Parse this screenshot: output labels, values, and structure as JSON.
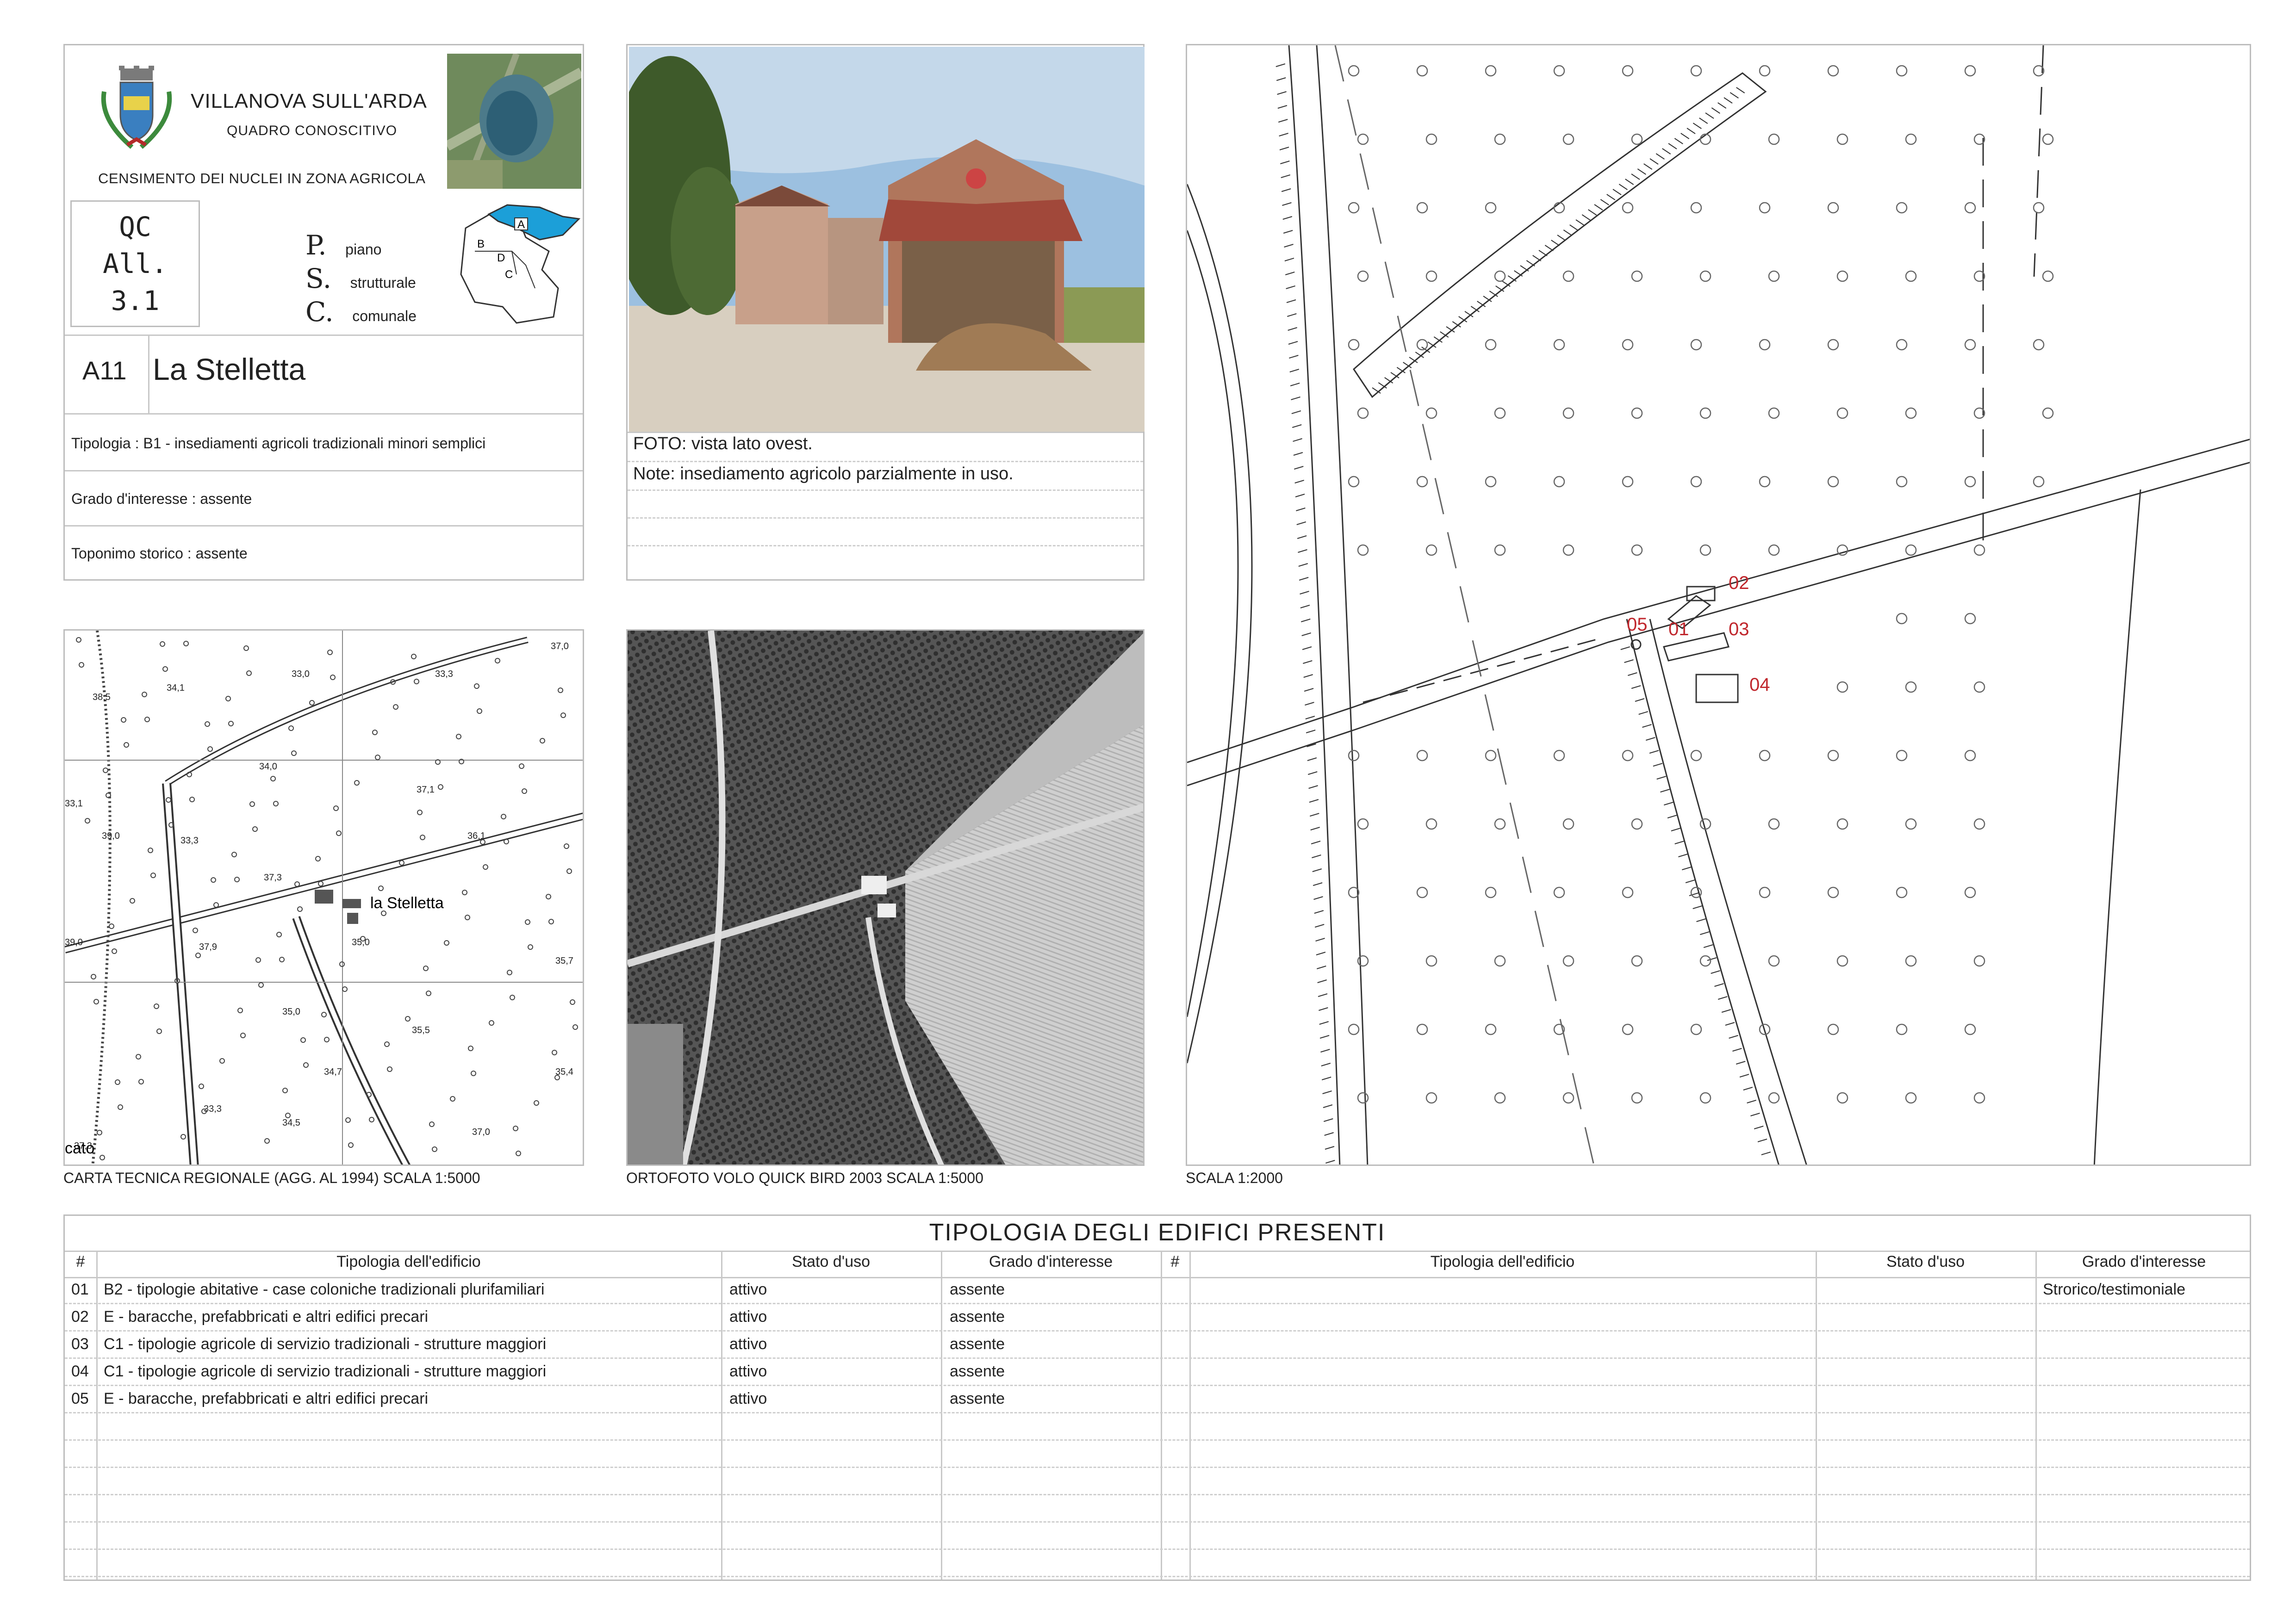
{
  "header": {
    "town": "VILLANOVA SULL'ARDA",
    "subtitle": "QUADRO CONOSCITIVO",
    "census": "CENSIMENTO DEI NUCLEI IN ZONA AGRICOLA",
    "qc_lines": [
      "QC",
      "All.",
      "3.1"
    ],
    "psc": [
      {
        "letter": "P.",
        "word": "piano"
      },
      {
        "letter": "S.",
        "word": "strutturale"
      },
      {
        "letter": "C.",
        "word": "comunale"
      }
    ],
    "zones": [
      "A",
      "B",
      "C",
      "D"
    ],
    "code": "A11",
    "name": "La Stelletta",
    "tipologia": "Tipologia : B1 - insediamenti agricoli tradizionali minori semplici",
    "grado": "Grado d'interesse : assente",
    "toponimo": "Toponimo storico : assente"
  },
  "photo": {
    "caption": "FOTO: vista lato ovest.",
    "note": "Note: insediamento agricolo parzialmente in uso."
  },
  "maps": {
    "ctr_caption": "CARTA TECNICA REGIONALE (AGG. AL 1994) SCALA 1:5000",
    "ortho_caption": "ORTOFOTO VOLO QUICK BIRD 2003 SCALA 1:5000",
    "main_caption": "SCALA 1:2000",
    "ctr_place_name": "la Stelletta",
    "ctr_fragment": "cato",
    "ctr_elevations": [
      "37,0",
      "33,0",
      "33,3",
      "34,1",
      "38,5",
      "34,0",
      "37,1",
      "33,1",
      "39,0",
      "33,3",
      "36,1",
      "37,3",
      "35,0",
      "39,0",
      "37,9",
      "35,7",
      "35,0",
      "35,5",
      "34,7",
      "35,4",
      "33,3",
      "34,5",
      "37,0",
      "37,3"
    ],
    "building_labels": [
      "05",
      "01",
      "02",
      "03",
      "04"
    ]
  },
  "table": {
    "title": "TIPOLOGIA DEGLI EDIFICI PRESENTI",
    "headers": {
      "num": "#",
      "tipologia": "Tipologia dell'edificio",
      "stato": "Stato d'uso",
      "grado": "Grado d'interesse"
    },
    "right_grado_first": "Strorico/testimoniale",
    "rows": [
      {
        "num": "01",
        "tipologia": "B2 - tipologie abitative - case coloniche tradizionali plurifamiliari",
        "stato": "attivo",
        "grado": "assente"
      },
      {
        "num": "02",
        "tipologia": "E  - baracche, prefabbricati e altri edifici precari",
        "stato": "attivo",
        "grado": "assente"
      },
      {
        "num": "03",
        "tipologia": "C1 - tipologie agricole di servizio tradizionali - strutture maggiori",
        "stato": "attivo",
        "grado": "assente"
      },
      {
        "num": "04",
        "tipologia": "C1 - tipologie agricole di servizio tradizionali - strutture maggiori",
        "stato": "attivo",
        "grado": "assente"
      },
      {
        "num": "05",
        "tipologia": "E  - baracche, prefabbricati e altri edifici precari",
        "stato": "attivo",
        "grado": "assente"
      }
    ]
  },
  "colors": {
    "frame": "#bdbdbd",
    "accent_blue": "#1c9fd8",
    "label_red": "#c0272d"
  }
}
